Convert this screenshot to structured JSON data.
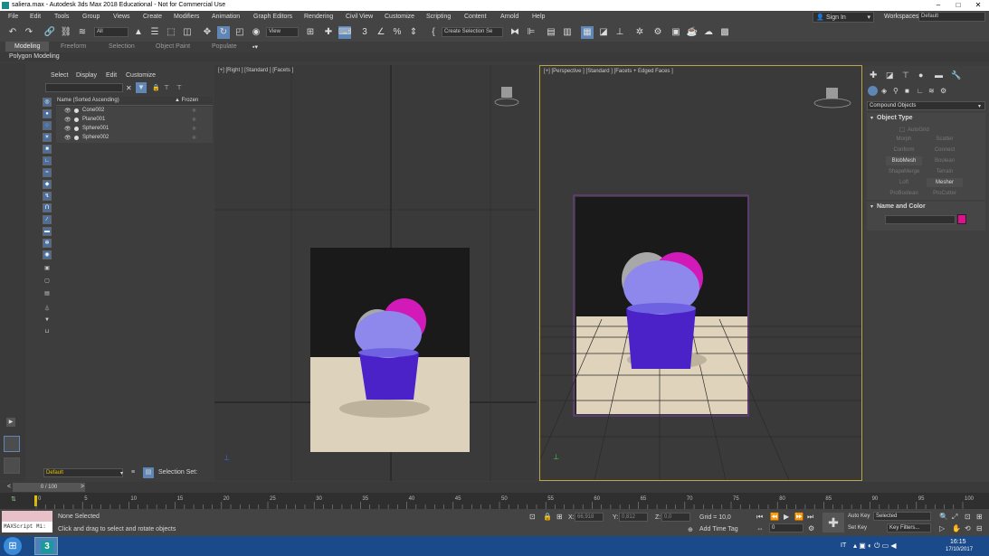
{
  "window": {
    "title": "saliera.max - Autodesk 3ds Max 2018 Educational - Not for Commercial Use"
  },
  "menu": [
    "File",
    "Edit",
    "Tools",
    "Group",
    "Views",
    "Create",
    "Modifiers",
    "Animation",
    "Graph Editors",
    "Rendering",
    "Civil View",
    "Customize",
    "Scripting",
    "Content",
    "Arnold",
    "Help"
  ],
  "account": {
    "sign_in": "Sign In",
    "workspaces_label": "Workspaces:",
    "workspace_value": "Default"
  },
  "toolbar": {
    "filter_value": "All",
    "view_value": "View",
    "selection_set": "Create Selection Se"
  },
  "ribbon": {
    "tabs": [
      "Modeling",
      "Freeform",
      "Selection",
      "Object Paint",
      "Populate"
    ],
    "active_tab": "Modeling",
    "sub_label": "Polygon Modeling"
  },
  "scene_explorer": {
    "menu": [
      "Select",
      "Display",
      "Edit",
      "Customize"
    ],
    "col_name": "Name (Sorted Ascending)",
    "col_frozen": "▲ Frozen",
    "items": [
      "Cone002",
      "Plane001",
      "Sphere001",
      "Sphere002"
    ],
    "layer_value": "Default",
    "selection_set_label": "Selection Set:"
  },
  "viewports": {
    "right_label": "[+] [Right ] [Standard ] [Facets ]",
    "persp_label": "[+] [Perspective ] [Standard ] [Facets + Edged Faces ]"
  },
  "command_panel": {
    "category": "Compound Objects",
    "object_type_header": "Object Type",
    "autogrid": "AutoGrid",
    "buttons": [
      "Morph",
      "Scatter",
      "Conform",
      "Connect",
      "BlobMesh",
      "Boolean",
      "ShapeMerge",
      "Terrain",
      "Loft",
      "Mesher",
      "ProBoolean",
      "ProCutter"
    ],
    "name_color_header": "Name and Color",
    "object_color": "#e0108c"
  },
  "timeline": {
    "frame": "0 / 100",
    "ticks": [
      "0",
      "5",
      "10",
      "15",
      "20",
      "25",
      "30",
      "35",
      "40",
      "45",
      "50",
      "55",
      "60",
      "65",
      "70",
      "75",
      "80",
      "85",
      "90",
      "95",
      "100"
    ]
  },
  "status": {
    "maxscript": "MAXScript Mi:",
    "selected": "None Selected",
    "prompt": "Click and drag to select and rotate objects",
    "x_label": "X:",
    "x_value": "66,918",
    "y_label": "Y:",
    "y_value": "0,812",
    "z_label": "Z:",
    "z_value": "0,0",
    "grid": "Grid = 10,0",
    "add_time_tag": "Add Time Tag",
    "auto_key": "Auto Key",
    "set_key": "Set Key",
    "selected_dd": "Selected",
    "key_filters": "Key Filters...",
    "frame_value": "0"
  },
  "taskbar": {
    "lang": "IT",
    "time": "16:15",
    "date": "17/10/2017"
  },
  "colors": {
    "accent": "#5f86b4",
    "viewport_border": "#b9a64a",
    "cone": "#4a22c8",
    "sphere_magenta": "#d21ab8"
  }
}
